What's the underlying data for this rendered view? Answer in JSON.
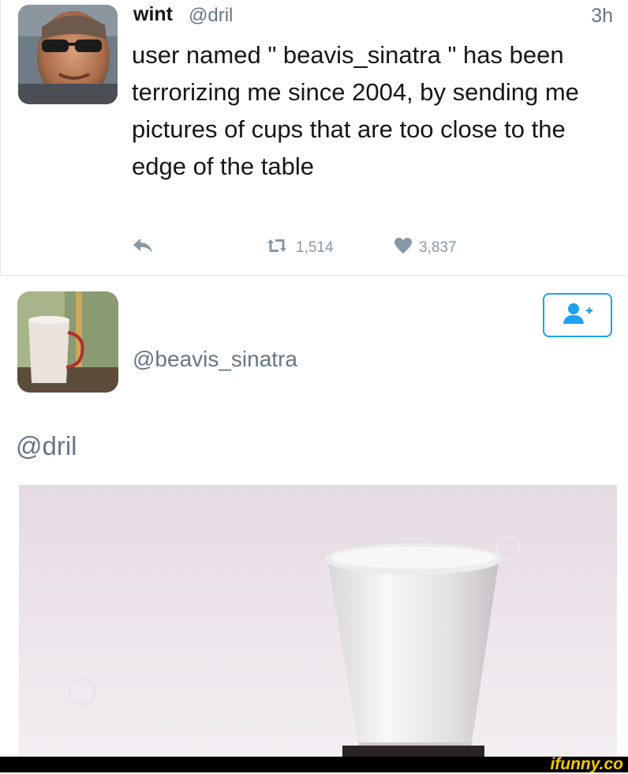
{
  "tweet": {
    "author_name": "wint",
    "author_handle": "@dril",
    "time": "3h",
    "text": "user named \" beavis_sinatra \" has been terrorizing me since 2004, by sending me pictures of cups that are too close to the edge of the table",
    "retweets": "1,514",
    "likes": "3,837"
  },
  "profile": {
    "handle": "@beavis_sinatra"
  },
  "reply": {
    "mention": "@dril"
  },
  "watermark": {
    "brand": "ifunny.co"
  },
  "icons": {
    "reply": "reply-icon",
    "retweet": "retweet-icon",
    "like": "heart-icon",
    "follow": "add-user-icon"
  },
  "colors": {
    "text": "#14171a",
    "muted": "#657786",
    "action": "#8899a6",
    "accent": "#1da1f2",
    "brand": "#f5c800"
  }
}
